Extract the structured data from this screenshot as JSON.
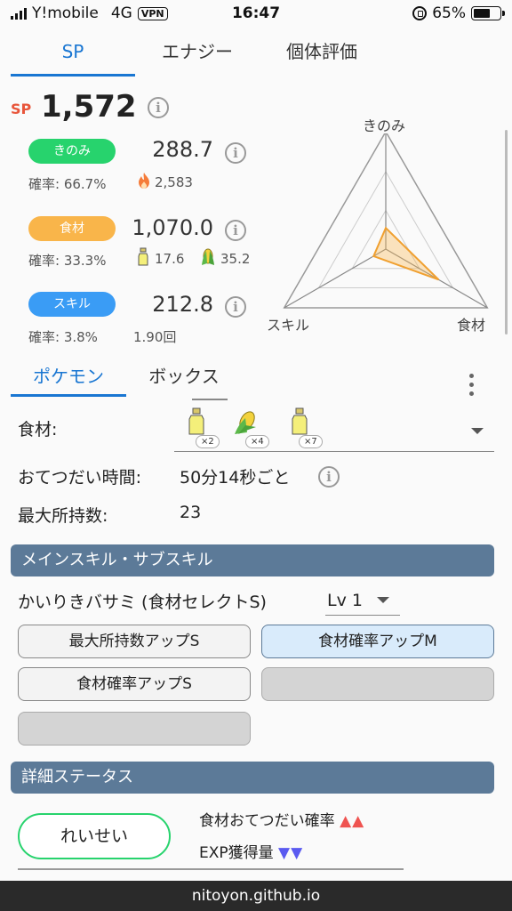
{
  "status_bar": {
    "carrier": "Y!mobile",
    "network": "4G",
    "vpn": "VPN",
    "time": "16:47",
    "battery": "65%",
    "battery_level": 0.65
  },
  "top_tabs": [
    "SP",
    "エナジー",
    "個体評価"
  ],
  "sp": {
    "label": "SP",
    "value": "1,572"
  },
  "berry": {
    "label": "きのみ",
    "value": "288.7",
    "rate": "確率: 66.7%",
    "energy": "2,583",
    "color": "#27d36d"
  },
  "ingredient": {
    "label": "食材",
    "value": "1,070.0",
    "rate": "確率: 33.3%",
    "count1": "17.6",
    "count2": "35.2",
    "color": "#f9b54a"
  },
  "skill": {
    "label": "スキル",
    "value": "212.8",
    "rate": "確率: 3.8%",
    "count": "1.90回",
    "color": "#3a9cf5"
  },
  "radar": {
    "labels": [
      "きのみ",
      "食材",
      "スキル"
    ],
    "values": [
      0.18,
      0.52,
      0.12
    ]
  },
  "sub_tabs": [
    "ポケモン",
    "ボックス"
  ],
  "ingredients_label": "食材:",
  "ingredients": [
    {
      "icon": "oil-bottle-icon",
      "count": "×2"
    },
    {
      "icon": "corn-icon",
      "count": "×4"
    },
    {
      "icon": "oil-bottle-icon",
      "count": "×7"
    }
  ],
  "help_time": {
    "label": "おてつだい時間:",
    "value": "50分14秒ごと"
  },
  "max_carry": {
    "label": "最大所持数:",
    "value": "23"
  },
  "skills_section": {
    "title": "メインスキル・サブスキル",
    "main_skill": "かいりきバサミ (食材セレクトS)",
    "level": "Lv 1",
    "sub_skills": [
      "最大所持数アップS",
      "食材確率アップM",
      "食材確率アップS",
      "",
      ""
    ]
  },
  "detail_section": {
    "title": "詳細ステータス",
    "nature": "れいせい",
    "up_effect": "食材おてつだい確率",
    "up_marks": "▲▲",
    "down_effect": "EXP獲得量",
    "down_marks": "▼▼"
  },
  "footer": "nitoyon.github.io"
}
